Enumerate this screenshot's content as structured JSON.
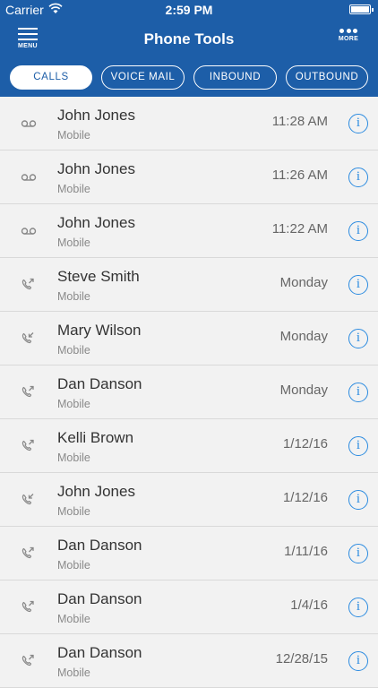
{
  "status": {
    "carrier": "Carrier",
    "time": "2:59 PM"
  },
  "nav": {
    "title": "Phone Tools",
    "menu_label": "MENU",
    "more_label": "MORE"
  },
  "tabs": [
    {
      "label": "CALLS",
      "active": true
    },
    {
      "label": "VOICE MAIL",
      "active": false
    },
    {
      "label": "INBOUND",
      "active": false
    },
    {
      "label": "OUTBOUND",
      "active": false
    }
  ],
  "calls": [
    {
      "name": "John Jones",
      "sub": "Mobile",
      "time": "11:28 AM",
      "icon": "voicemail-icon"
    },
    {
      "name": "John Jones",
      "sub": "Mobile",
      "time": "11:26 AM",
      "icon": "voicemail-icon"
    },
    {
      "name": "John Jones",
      "sub": "Mobile",
      "time": "11:22 AM",
      "icon": "voicemail-icon"
    },
    {
      "name": "Steve Smith",
      "sub": "Mobile",
      "time": "Monday",
      "icon": "outgoing-call-icon"
    },
    {
      "name": "Mary Wilson",
      "sub": "Mobile",
      "time": "Monday",
      "icon": "incoming-call-icon"
    },
    {
      "name": "Dan Danson",
      "sub": "Mobile",
      "time": "Monday",
      "icon": "outgoing-call-icon"
    },
    {
      "name": "Kelli Brown",
      "sub": "Mobile",
      "time": "1/12/16",
      "icon": "outgoing-call-icon"
    },
    {
      "name": "John Jones",
      "sub": "Mobile",
      "time": "1/12/16",
      "icon": "incoming-call-icon"
    },
    {
      "name": "Dan Danson",
      "sub": "Mobile",
      "time": "1/11/16",
      "icon": "outgoing-call-icon"
    },
    {
      "name": "Dan Danson",
      "sub": "Mobile",
      "time": "1/4/16",
      "icon": "outgoing-call-icon"
    },
    {
      "name": "Dan Danson",
      "sub": "Mobile",
      "time": "12/28/15",
      "icon": "outgoing-call-icon"
    }
  ],
  "colors": {
    "brand": "#1d5ea8",
    "info": "#2b8be0"
  },
  "info_glyph": "i"
}
